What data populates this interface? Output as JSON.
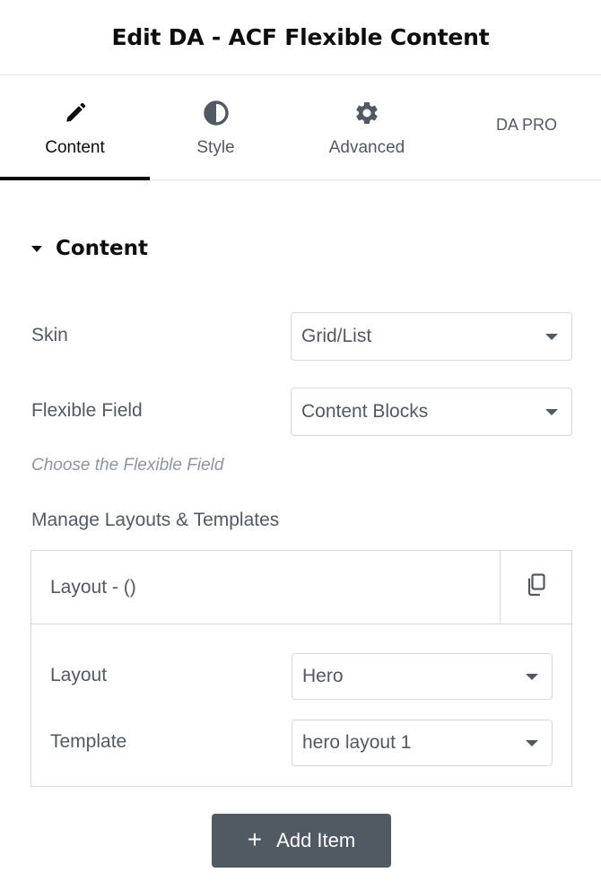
{
  "header": {
    "title": "Edit DA - ACF Flexible Content"
  },
  "tabs": [
    {
      "label": "Content",
      "icon": "pencil-icon",
      "active": true
    },
    {
      "label": "Style",
      "icon": "half-circle-icon",
      "active": false
    },
    {
      "label": "Advanced",
      "icon": "gear-icon",
      "active": false
    },
    {
      "label": "DA PRO",
      "icon": "",
      "active": false
    }
  ],
  "section": {
    "title": "Content"
  },
  "fields": {
    "skin": {
      "label": "Skin",
      "value": "Grid/List"
    },
    "flexible_field": {
      "label": "Flexible Field",
      "value": "Content Blocks"
    },
    "hint": "Choose the Flexible Field",
    "manage_label": "Manage Layouts & Templates"
  },
  "repeater": {
    "item_title": "Layout - ()",
    "layout": {
      "label": "Layout",
      "value": "Hero"
    },
    "template": {
      "label": "Template",
      "value": "hero layout 1"
    }
  },
  "add_button": {
    "label": "Add Item"
  },
  "colors": {
    "text_dark": "#0c0d0e",
    "text_muted": "#515962",
    "border": "#d5d8dc",
    "button_bg": "#515962"
  }
}
